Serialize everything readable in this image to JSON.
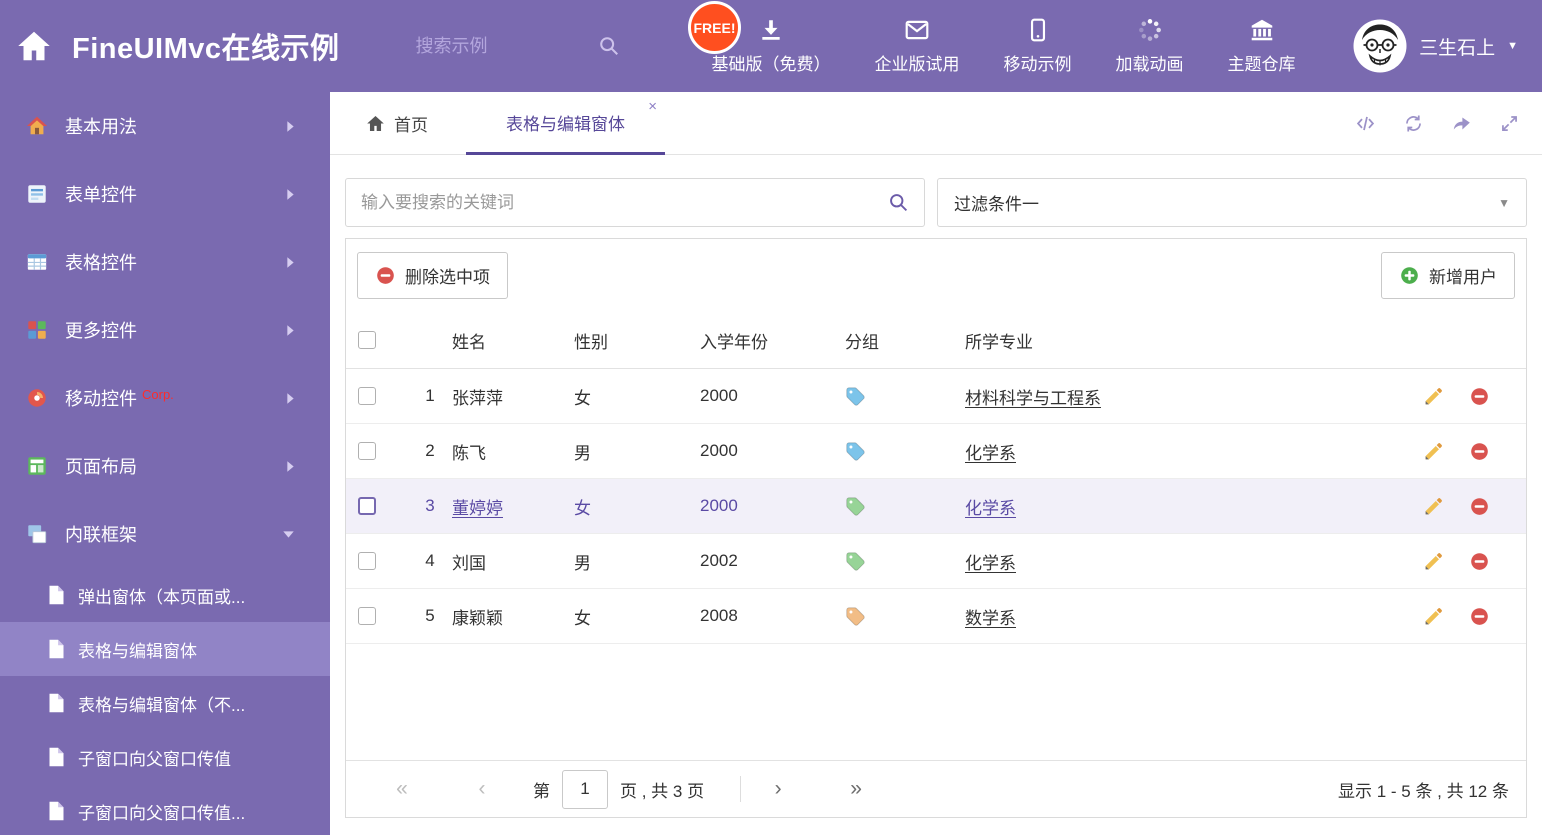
{
  "header": {
    "title": "FineUIMvc在线示例",
    "search_placeholder": "搜索示例",
    "free_badge": "FREE!",
    "nav": [
      {
        "label": "基础版（免费）",
        "icon": "download-icon"
      },
      {
        "label": "企业版试用",
        "icon": "envelope-icon"
      },
      {
        "label": "移动示例",
        "icon": "mobile-icon"
      },
      {
        "label": "加载动画",
        "icon": "spinner-icon"
      },
      {
        "label": "主题仓库",
        "icon": "bank-icon"
      }
    ],
    "user_name": "三生石上"
  },
  "sidebar": {
    "items": [
      {
        "label": "基本用法"
      },
      {
        "label": "表单控件"
      },
      {
        "label": "表格控件"
      },
      {
        "label": "更多控件"
      },
      {
        "label": "移动控件",
        "badge": "Corp."
      },
      {
        "label": "页面布局"
      },
      {
        "label": "内联框架"
      }
    ],
    "subitems": [
      {
        "label": "弹出窗体（本页面或..."
      },
      {
        "label": "表格与编辑窗体"
      },
      {
        "label": "表格与编辑窗体（不..."
      },
      {
        "label": "子窗口向父窗口传值"
      },
      {
        "label": "子窗口向父窗口传值..."
      }
    ]
  },
  "tabs": {
    "home": "首页",
    "active": "表格与编辑窗体",
    "close": "×"
  },
  "filter": {
    "search_placeholder": "输入要搜索的关键词",
    "selected": "过滤条件一"
  },
  "toolbar": {
    "delete": "删除选中项",
    "add": "新增用户"
  },
  "table": {
    "headers": {
      "name": "姓名",
      "gender": "性别",
      "year": "入学年份",
      "group": "分组",
      "major": "所学专业"
    },
    "rows": [
      {
        "num": "1",
        "name": "张萍萍",
        "gender": "女",
        "year": "2000",
        "tag_color": "#7cc4ea",
        "major": "材料科学与工程系"
      },
      {
        "num": "2",
        "name": "陈飞",
        "gender": "男",
        "year": "2000",
        "tag_color": "#7cc4ea",
        "major": "化学系"
      },
      {
        "num": "3",
        "name": "董婷婷",
        "gender": "女",
        "year": "2000",
        "tag_color": "#97d497",
        "major": "化学系",
        "selected": true
      },
      {
        "num": "4",
        "name": "刘国",
        "gender": "男",
        "year": "2002",
        "tag_color": "#97d497",
        "major": "化学系"
      },
      {
        "num": "5",
        "name": "康颖颖",
        "gender": "女",
        "year": "2008",
        "tag_color": "#f2bd86",
        "major": "数学系"
      }
    ]
  },
  "pagination": {
    "first": "«",
    "prev": "‹",
    "next": "›",
    "last": "»",
    "label_page": "第",
    "current_page": "1",
    "label_total": "页 , 共 3 页",
    "summary": "显示 1 - 5 条 , 共 12 条"
  },
  "icons": {
    "caret_down": "▼"
  },
  "colors": {
    "theme_purple": "#7a6ab0",
    "active_item_purple": "#9184c6",
    "accent_purple": "#564798",
    "selected_row_bg": "#f2f0f9",
    "free_badge_red": "#ff4f1f",
    "delete_red": "#d9534f",
    "add_green": "#4cae4c",
    "pencil_yellow": "#f0c052"
  }
}
